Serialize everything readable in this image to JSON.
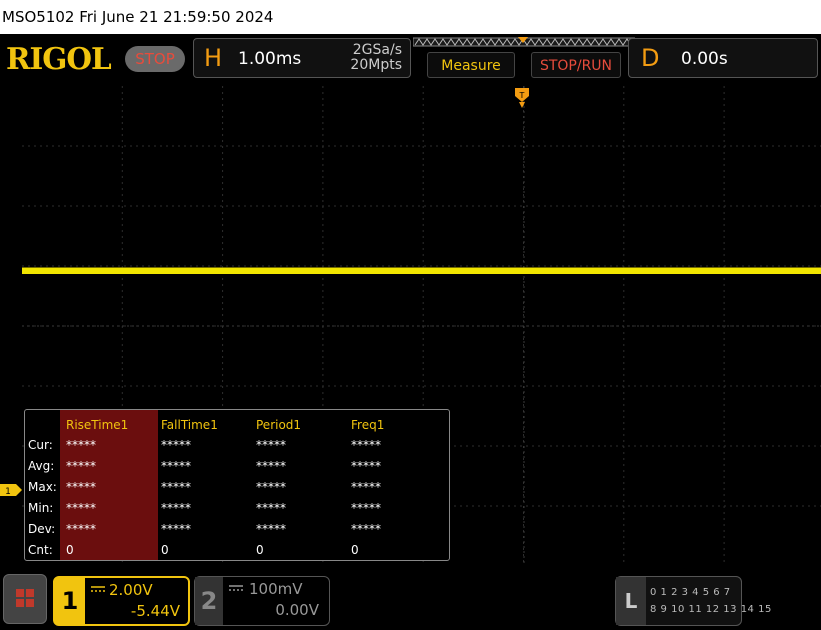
{
  "header": {
    "title": "MSO5102  Fri June 21 21:59:50 2024"
  },
  "topbar": {
    "logo": "RIGOL",
    "run_state": "STOP",
    "horizontal": {
      "label": "H",
      "timebase": "1.00ms",
      "sample_rate": "2GSa/s",
      "memory_depth": "20Mpts"
    },
    "measure_label": "Measure",
    "stoprun_label": "STOP/RUN",
    "delay": {
      "label": "D",
      "value": "0.00s"
    }
  },
  "measurements": {
    "columns": [
      "RiseTime1",
      "FallTime1",
      "Period1",
      "Freq1"
    ],
    "rows": [
      {
        "label": "Cur:",
        "values": [
          "*****",
          "*****",
          "*****",
          "*****"
        ]
      },
      {
        "label": "Avg:",
        "values": [
          "*****",
          "*****",
          "*****",
          "*****"
        ]
      },
      {
        "label": "Max:",
        "values": [
          "*****",
          "*****",
          "*****",
          "*****"
        ]
      },
      {
        "label": "Min:",
        "values": [
          "*****",
          "*****",
          "*****",
          "*****"
        ]
      },
      {
        "label": "Dev:",
        "values": [
          "*****",
          "*****",
          "*****",
          "*****"
        ]
      },
      {
        "label": "Cnt:",
        "values": [
          "0",
          "0",
          "0",
          "0"
        ]
      }
    ]
  },
  "trace": {
    "channel_marker": "1",
    "color": "#f1e500"
  },
  "bottombar": {
    "ch1": {
      "number": "1",
      "scale": "2.00V",
      "offset": "-5.44V"
    },
    "ch2": {
      "number": "2",
      "scale": "100mV",
      "offset": "0.00V"
    },
    "logic": {
      "label": "L",
      "row1": "0 1 2 3  4 5 6 7",
      "row2": "8 9 10 11 12 13 14 15"
    }
  },
  "colors": {
    "accent": "#f1c40f",
    "stop": "#e74c3c",
    "orange": "#f39c12",
    "highlight": "#6b0e0e"
  }
}
